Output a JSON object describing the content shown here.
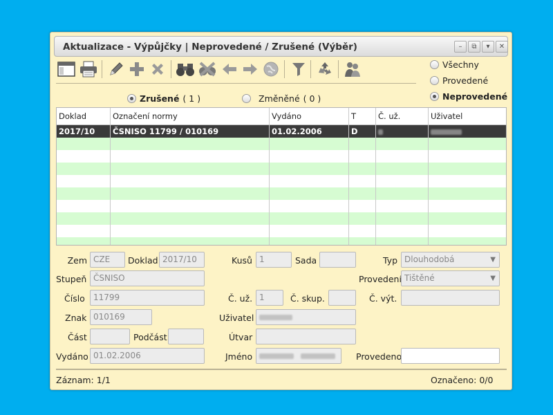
{
  "window": {
    "title": "Aktualizace - Výpůjčky | Neprovedené / Zrušené (Výběr)",
    "buttons": [
      "–",
      "⧉",
      "▾",
      "✕"
    ]
  },
  "toolbar": {
    "icons": [
      "window-icon",
      "printer-icon",
      "pencil-icon",
      "plus-icon",
      "delete-icon",
      "binoculars-icon",
      "filter-off-icon",
      "arrow-left-icon",
      "arrow-right-icon",
      "globe-icon",
      "funnel-icon",
      "recycle-icon",
      "users-icon"
    ]
  },
  "view_filter": {
    "options": [
      "Všechny",
      "Provedené",
      "Neprovedené"
    ],
    "selected": "Neprovedené"
  },
  "state_filter": {
    "zrusene_label": "Zrušené",
    "zrusene_count": "( 1 )",
    "zmenene_label": "Změněné",
    "zmenene_count": "( 0 )",
    "selected": "Zrušené"
  },
  "grid": {
    "columns": [
      "Doklad",
      "Označení normy",
      "Vydáno",
      "T",
      "Č. už.",
      "Uživatel"
    ],
    "rows": [
      {
        "doklad": "2017/10",
        "oznaceni": "ČSNISO 11799 / 010169",
        "vydano": "01.02.2006",
        "t": "D",
        "c_uz": "",
        "uzivatel": ""
      }
    ]
  },
  "form": {
    "zem_label": "Zem",
    "zem_value": "CZE",
    "doklad_label": "Doklad",
    "doklad_value": "2017/10",
    "kusu_label": "Kusů",
    "kusu_value": "1",
    "sada_label": "Sada",
    "sada_value": "",
    "typ_label": "Typ",
    "typ_value": "Dlouhodobá",
    "stupen_label": "Stupeň",
    "stupen_value": "ČSNISO",
    "provedeni_label": "Provedení",
    "provedeni_value": "Tištěné",
    "cislo_label": "Číslo",
    "cislo_value": "11799",
    "c_uz_label": "Č. už.",
    "c_uz_value": "1",
    "c_skup_label": "Č. skup.",
    "c_skup_value": "",
    "c_vyt_label": "Č. výt.",
    "c_vyt_value": "",
    "znak_label": "Znak",
    "znak_value": "010169",
    "uzivatel_label": "Uživatel",
    "uzivatel_value": "",
    "cast_label": "Část",
    "cast_value": "",
    "podcast_label": "Podčást",
    "podcast_value": "",
    "utvar_label": "Útvar",
    "utvar_value": "",
    "vydano_label": "Vydáno",
    "vydano_value": "01.02.2006",
    "jmeno_label": "Jméno",
    "jmeno_value": "",
    "provedeno_label": "Provedeno",
    "provedeno_value": ""
  },
  "status": {
    "zaznam_label": "Záznam:",
    "zaznam_value": "1/1",
    "oznaceno_label": "Označeno:",
    "oznaceno_value": "0/0"
  },
  "colors": {
    "background": "#00aeef",
    "panel": "#fdf3c6",
    "row_selected": "#3a3a3a",
    "row_alt": "#d6fcd2"
  }
}
